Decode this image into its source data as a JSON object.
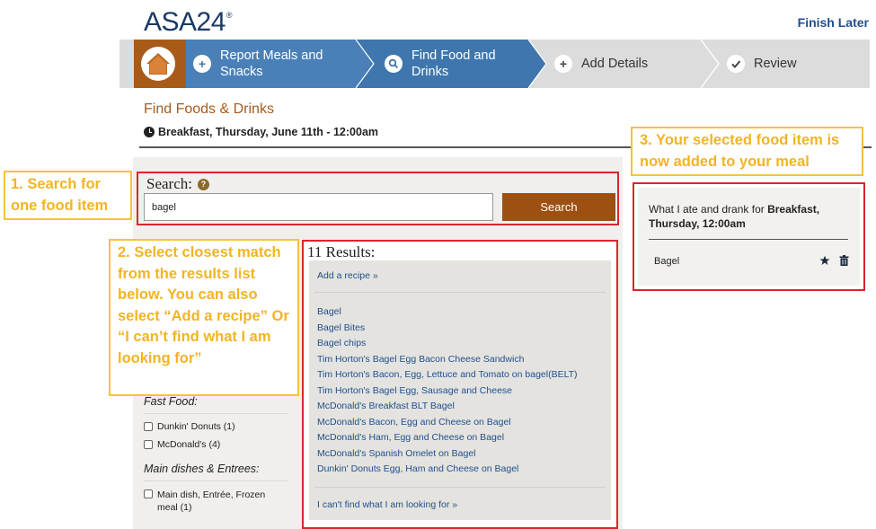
{
  "header": {
    "logo_text": "ASA24",
    "logo_mark": "®",
    "finish_later": "Finish Later"
  },
  "steps": [
    {
      "label": "Report Meals and Snacks",
      "line1": "Report Meals and",
      "line2": "Snacks",
      "icon": "plus-icon",
      "state": "done"
    },
    {
      "label": "Find Food and Drinks",
      "line1": "Find Food and",
      "line2": "Drinks",
      "icon": "search-icon",
      "state": "current"
    },
    {
      "label": "Add Details",
      "icon": "plus-icon",
      "state": "upcoming"
    },
    {
      "label": "Review",
      "icon": "check-icon",
      "state": "upcoming"
    }
  ],
  "page": {
    "title": "Find Foods & Drinks",
    "meal_line": "Breakfast, Thursday, June 11th - 12:00am"
  },
  "search": {
    "label": "Search:",
    "help": "?",
    "value": "bagel",
    "button": "Search"
  },
  "results": {
    "title": "11 Results:",
    "add_recipe": "Add a recipe »",
    "items": [
      "Bagel",
      "Bagel Bites",
      "Bagel chips",
      "Tim Horton's Bagel Egg Bacon Cheese Sandwich",
      "Tim Horton's Bacon, Egg, Lettuce and Tomato on bagel(BELT)",
      "Tim Horton's Bagel Egg, Sausage and Cheese",
      "McDonald's Breakfast BLT Bagel",
      "McDonald's Bacon, Egg and Cheese on Bagel",
      "McDonald's Ham, Egg and Cheese on Bagel",
      "McDonald's Spanish Omelet on Bagel",
      "Dunkin' Donuts Egg, Ham and Cheese on Bagel"
    ],
    "cant_find": "I can't find what I am looking for »"
  },
  "filters": {
    "fast_food": {
      "heading": "Fast Food:",
      "options": [
        "Dunkin' Donuts (1)",
        "McDonald's (4)"
      ]
    },
    "main_dishes": {
      "heading": "Main dishes & Entrees:",
      "options": [
        "Main dish, Entrée, Frozen meal (1)"
      ]
    }
  },
  "meal_panel": {
    "prefix": "What I ate and drank for ",
    "meal_bold": "Breakfast, Thursday, 12:00am",
    "items": [
      "Bagel"
    ]
  },
  "callouts": {
    "c1": "1. Search for one food item",
    "c2": "2. Select closest match from the results list below. You can also select “Add a recipe” Or “I can’t find what I am looking for”",
    "c3": "3. Your selected food item is now added to your meal"
  },
  "colors": {
    "brand_brown": "#a85a19",
    "step_blue": "#3f76ad",
    "link_blue": "#1f4f8f",
    "highlight_red": "#d8262e",
    "callout_yellow": "#f2b423"
  }
}
